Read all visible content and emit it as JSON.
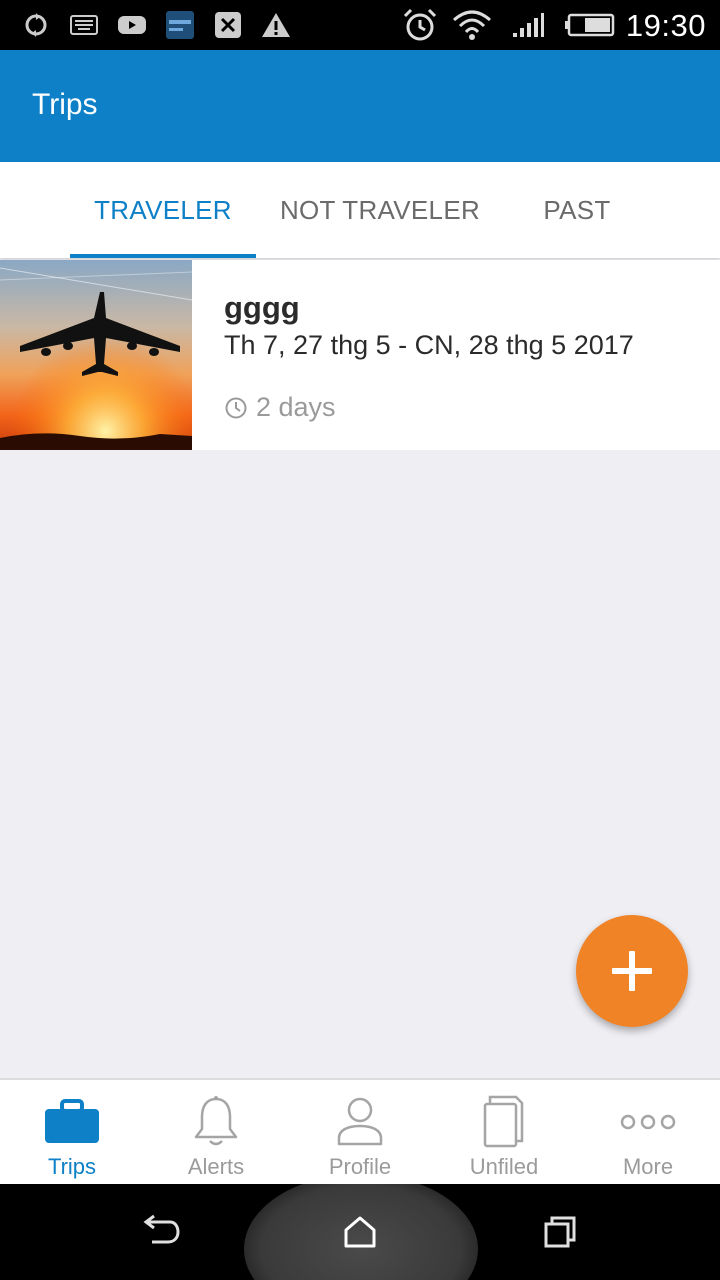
{
  "status_bar": {
    "time": "19:30",
    "icons": [
      "sync-icon",
      "keyboard-icon",
      "youtube-icon",
      "app-notification-icon",
      "clipboard-icon",
      "warning-icon",
      "alarm-icon",
      "wifi-icon",
      "signal-icon",
      "battery-icon"
    ]
  },
  "app_bar": {
    "title": "Trips"
  },
  "tabs": [
    {
      "label": "TRAVELER",
      "active": true
    },
    {
      "label": "NOT TRAVELER",
      "active": false
    },
    {
      "label": "PAST",
      "active": false
    }
  ],
  "trip": {
    "name": "gggg",
    "dates": "Th 7, 27 thg 5 - CN, 28 thg 5 2017",
    "duration": "2 days",
    "image": "airplane-sunset-thumbnail"
  },
  "fab": {
    "icon": "plus-icon"
  },
  "bottom_nav": [
    {
      "label": "Trips",
      "icon": "briefcase-icon",
      "active": true
    },
    {
      "label": "Alerts",
      "icon": "bell-icon",
      "active": false
    },
    {
      "label": "Profile",
      "icon": "person-icon",
      "active": false
    },
    {
      "label": "Unfiled",
      "icon": "documents-icon",
      "active": false
    },
    {
      "label": "More",
      "icon": "more-dots-icon",
      "active": false
    }
  ],
  "colors": {
    "primary": "#0d80c7",
    "accent": "#f08325",
    "background": "#efeef3",
    "inactive": "#9b9b9b"
  }
}
